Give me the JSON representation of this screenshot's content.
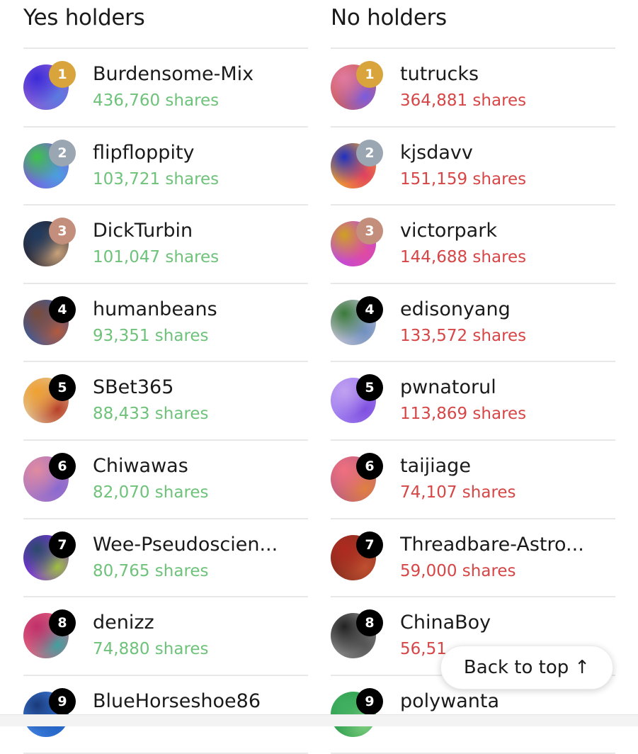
{
  "yes_title": "Yes holders",
  "no_title": "No holders",
  "yes_holders": [
    {
      "rank": "1",
      "name": "Burdensome-Mix",
      "shares": "436,760 shares",
      "badge": "gold",
      "avatar": [
        "#3b2bd9",
        "#5a7be0",
        "#8a5cd6"
      ]
    },
    {
      "rank": "2",
      "name": "flipfloppity",
      "shares": "103,721 shares",
      "badge": "silver",
      "avatar": [
        "#3cc44a",
        "#4aa0e0",
        "#7c5ce0"
      ]
    },
    {
      "rank": "3",
      "name": "DickTurbin",
      "shares": "101,047 shares",
      "badge": "bronze",
      "avatar": [
        "#1f3a5f",
        "#c9a27a",
        "#2b2b3a"
      ]
    },
    {
      "rank": "4",
      "name": "humanbeans",
      "shares": "93,351 shares",
      "badge": "plain",
      "avatar": [
        "#7a4b3a",
        "#b35a3d",
        "#3d5a9a"
      ]
    },
    {
      "rank": "5",
      "name": "SBet365",
      "shares": "88,433 shares",
      "badge": "plain",
      "avatar": [
        "#f0a030",
        "#b8402a",
        "#e0c090"
      ]
    },
    {
      "rank": "6",
      "name": "Chiwawas",
      "shares": "82,070 shares",
      "badge": "plain",
      "avatar": [
        "#e08aa0",
        "#8a6ad0",
        "#b07ac0"
      ]
    },
    {
      "rank": "7",
      "name": "Wee-Pseudoscien...",
      "shares": "80,765 shares",
      "badge": "plain",
      "avatar": [
        "#2a4a6a",
        "#a0c040",
        "#7a30e0"
      ]
    },
    {
      "rank": "8",
      "name": "denizz",
      "shares": "74,880 shares",
      "badge": "plain",
      "avatar": [
        "#c0306a",
        "#40a0a0",
        "#e06080"
      ]
    },
    {
      "rank": "9",
      "name": "BlueHorseshoe86",
      "shares": "",
      "badge": "plain",
      "avatar": [
        "#1a3a7a",
        "#2060c0",
        "#4080e0"
      ]
    }
  ],
  "no_holders": [
    {
      "rank": "1",
      "name": "tutrucks",
      "shares": "364,881 shares",
      "badge": "gold",
      "avatar": [
        "#e07aa0",
        "#7a5ce0",
        "#d06060"
      ]
    },
    {
      "rank": "2",
      "name": "kjsdavv",
      "shares": "151,159 shares",
      "badge": "silver",
      "avatar": [
        "#2030c0",
        "#e04060",
        "#f0a030"
      ]
    },
    {
      "rank": "3",
      "name": "victorpark",
      "shares": "144,688 shares",
      "badge": "bronze",
      "avatar": [
        "#d0a020",
        "#e04aa0",
        "#c04ae0"
      ]
    },
    {
      "rank": "4",
      "name": "edisonyang",
      "shares": "133,572 shares",
      "badge": "plain",
      "avatar": [
        "#3a7a3a",
        "#7090c0",
        "#c0c0d0"
      ]
    },
    {
      "rank": "5",
      "name": "pwnatorul",
      "shares": "113,869 shares",
      "badge": "plain",
      "avatar": [
        "#c0a0f0",
        "#8050e0",
        "#a080f0"
      ]
    },
    {
      "rank": "6",
      "name": "taijiage",
      "shares": "74,107 shares",
      "badge": "plain",
      "avatar": [
        "#f07080",
        "#e08040",
        "#c06080"
      ]
    },
    {
      "rank": "7",
      "name": "Threadbare-Astro...",
      "shares": "59,000 shares",
      "badge": "plain",
      "avatar": [
        "#b02a20",
        "#c05030",
        "#8a3020"
      ]
    },
    {
      "rank": "8",
      "name": "ChinaBoy",
      "shares": "56,51",
      "badge": "plain",
      "avatar": [
        "#222222",
        "#555555",
        "#888888"
      ]
    },
    {
      "rank": "9",
      "name": "polywanta",
      "shares": "",
      "badge": "plain",
      "avatar": [
        "#40b060",
        "#80d080",
        "#30a050"
      ]
    }
  ],
  "back_to_top": "Back to top",
  "back_to_top_arrow": "↑"
}
